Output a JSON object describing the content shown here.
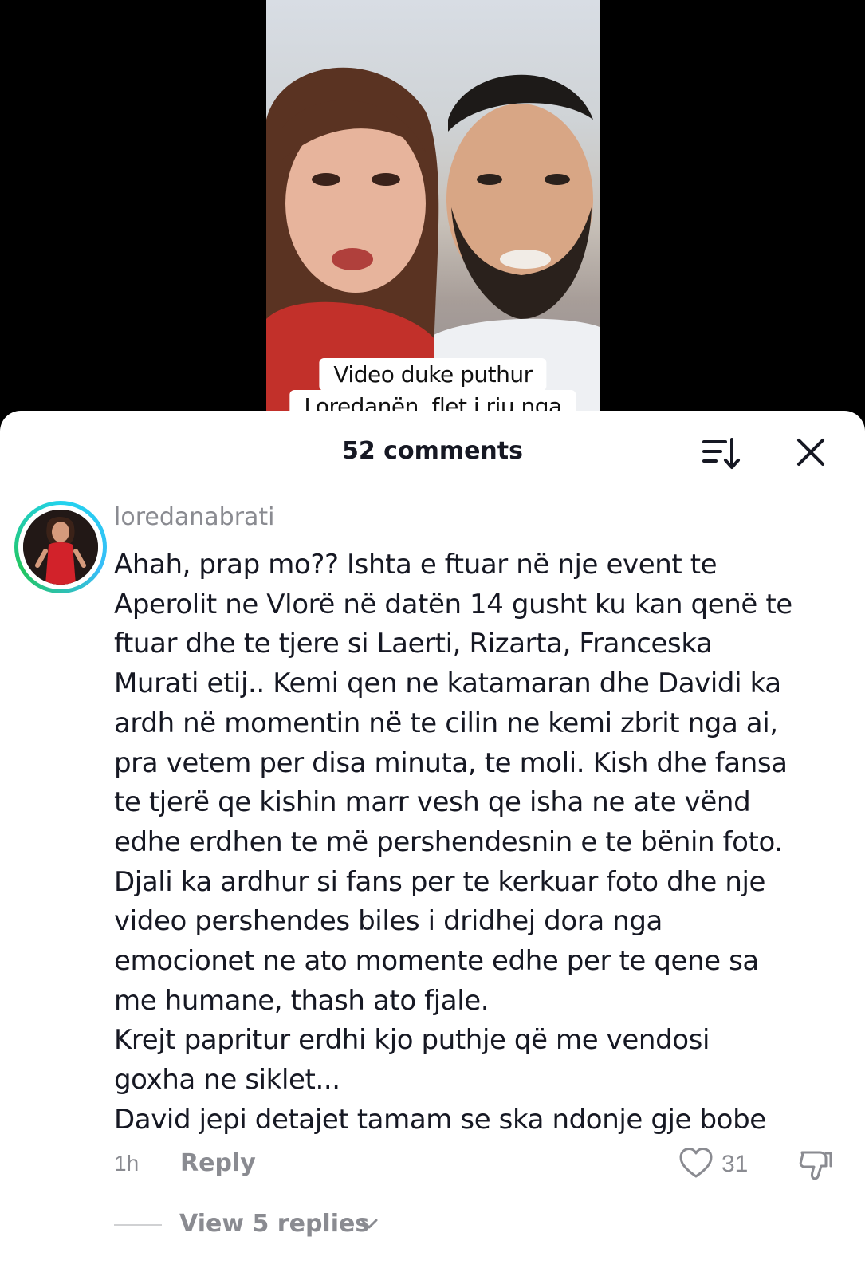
{
  "video": {
    "caption_line1": "Video duke puthur",
    "caption_line2": "Loredanën, flet i riu nga"
  },
  "sheet": {
    "comments_count": "52 comments",
    "sort_icon": "sort-icon",
    "close_icon": "close-icon"
  },
  "comment": {
    "username": "loredanabrati",
    "lines": [
      "Ahah, prap mo?? Ishta e ftuar në nje event te",
      "Aperolit ne Vlorë në datën 14 gusht ku kan qenë te",
      "ftuar dhe te tjere si Laerti, Rizarta, Franceska",
      "Murati etij.. Kemi qen ne katamaran dhe Davidi ka",
      "ardh në momentin në te cilin ne kemi zbrit nga ai,",
      "pra vetem per disa minuta, te moli. Kish dhe fansa",
      "te tjerë qe kishin marr vesh qe isha ne ate vënd",
      "edhe erdhen te më pershendesnin e te bënin foto.",
      "Djali ka ardhur si fans per te kerkuar foto dhe nje",
      "video pershendes biles i dridhej dora nga",
      "emocionet ne ato momente edhe per te qene sa",
      "me humane, thash ato fjale.",
      "Krejt papritur erdhi kjo puthje që me vendosi",
      "goxha ne siklet...",
      "David jepi detajet tamam se ska ndonje gje bobe"
    ],
    "time": "1h",
    "reply_label": "Reply",
    "like_count": "31",
    "view_replies": "View 5 replies",
    "icons": [
      "heart-icon",
      "dislike-icon",
      "chevron-down-icon"
    ]
  },
  "colors": {
    "text_primary": "#161823",
    "text_secondary": "#8a8b91",
    "avatar_ring": "#22d3ee"
  }
}
